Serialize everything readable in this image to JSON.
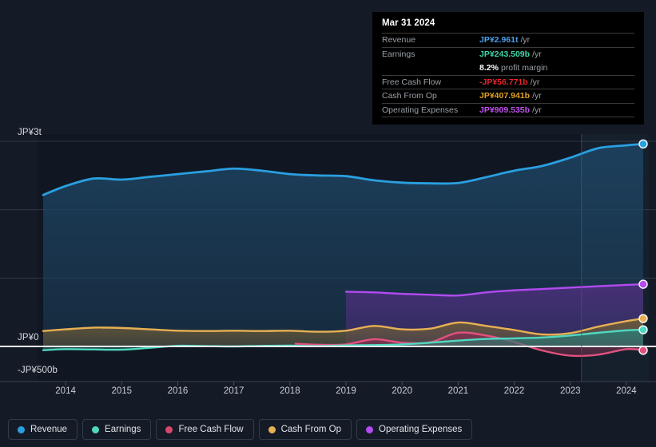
{
  "chart_data": {
    "type": "area",
    "title": "",
    "xlabel": "",
    "ylabel": "",
    "currency": "JP¥",
    "ylim": [
      -500,
      3000
    ],
    "ylim_unit": "billions JP¥",
    "grid": true,
    "legend_position": "bottom-left",
    "y_ticks": [
      {
        "label": "JP¥3t",
        "value": 3000
      },
      {
        "label": "JP¥0",
        "value": 0
      },
      {
        "label": "-JP¥500b",
        "value": -500
      }
    ],
    "y_gridlines": [
      3000,
      2000,
      1000,
      0
    ],
    "x_ticks": [
      "2014",
      "2015",
      "2016",
      "2017",
      "2018",
      "2019",
      "2020",
      "2021",
      "2022",
      "2023",
      "2024"
    ],
    "x_range": [
      "2013.5",
      "2024.4"
    ],
    "forecast_divider_x": "2023.2",
    "series": [
      {
        "name": "Revenue",
        "color": "#2a9fe0",
        "fill": "#1d4260",
        "x": [
          2013.6,
          2014.0,
          2014.5,
          2015.0,
          2015.5,
          2016.0,
          2016.5,
          2017.0,
          2017.5,
          2018.0,
          2018.5,
          2019.0,
          2019.5,
          2020.0,
          2020.5,
          2021.0,
          2021.5,
          2022.0,
          2022.5,
          2023.0,
          2023.5,
          2024.0,
          2024.3
        ],
        "values": [
          2215,
          2345,
          2455,
          2440,
          2480,
          2520,
          2560,
          2600,
          2570,
          2520,
          2500,
          2490,
          2430,
          2395,
          2385,
          2390,
          2475,
          2570,
          2640,
          2760,
          2900,
          2940,
          2961
        ]
      },
      {
        "name": "Earnings",
        "color": "#4fd8c0",
        "fill": "#2e7a72",
        "x": [
          2013.6,
          2014.0,
          2014.5,
          2015.0,
          2015.5,
          2016.0,
          2016.5,
          2017.0,
          2017.5,
          2018.0,
          2018.5,
          2019.0,
          2019.5,
          2020.0,
          2020.5,
          2021.0,
          2021.5,
          2022.0,
          2022.5,
          2023.0,
          2023.5,
          2024.0,
          2024.3
        ],
        "values": [
          -55,
          -40,
          -45,
          -48,
          -20,
          10,
          5,
          0,
          8,
          12,
          5,
          15,
          20,
          30,
          55,
          85,
          110,
          118,
          130,
          160,
          200,
          235,
          243.509
        ]
      },
      {
        "name": "Free Cash Flow",
        "color": "#e0527e",
        "fill": "#7a3350",
        "x": [
          2018.1,
          2018.5,
          2019.0,
          2019.5,
          2020.0,
          2020.5,
          2021.0,
          2021.5,
          2022.0,
          2022.5,
          2023.0,
          2023.5,
          2024.0,
          2024.3
        ],
        "values": [
          40,
          25,
          30,
          105,
          55,
          60,
          200,
          160,
          65,
          -60,
          -135,
          -120,
          -40,
          -56.771
        ]
      },
      {
        "name": "Cash From Op",
        "color": "#e8b053",
        "fill": "#6d5c38",
        "x": [
          2013.6,
          2014.0,
          2014.5,
          2015.0,
          2015.5,
          2016.0,
          2016.5,
          2017.0,
          2017.5,
          2018.0,
          2018.5,
          2019.0,
          2019.5,
          2020.0,
          2020.5,
          2021.0,
          2021.5,
          2022.0,
          2022.5,
          2023.0,
          2023.5,
          2024.0,
          2024.3
        ],
        "values": [
          225,
          250,
          275,
          270,
          250,
          230,
          225,
          230,
          225,
          230,
          215,
          230,
          300,
          250,
          260,
          350,
          300,
          240,
          175,
          195,
          290,
          370,
          407.941
        ]
      },
      {
        "name": "Operating Expenses",
        "color": "#b24bf0",
        "fill": "#4a2f7a",
        "x": [
          2019.0,
          2019.5,
          2020.0,
          2020.5,
          2021.0,
          2021.5,
          2022.0,
          2022.5,
          2023.0,
          2023.5,
          2024.0,
          2024.3
        ],
        "values": [
          800,
          790,
          770,
          755,
          745,
          790,
          820,
          840,
          860,
          880,
          900,
          909.535
        ]
      }
    ]
  },
  "tooltip": {
    "title": "Mar 31 2024",
    "rows": [
      {
        "key": "Revenue",
        "value": "JP¥2.961t",
        "unit": "/yr",
        "color": "#4a9fe8"
      },
      {
        "key": "Earnings",
        "value": "JP¥243.509b",
        "unit": "/yr",
        "color": "#3dd6a8"
      },
      {
        "key": "",
        "value": "8.2%",
        "unit": "profit margin",
        "color": "#ffffff"
      },
      {
        "key": "Free Cash Flow",
        "value": "-JP¥56.771b",
        "unit": "/yr",
        "color": "#e8252b"
      },
      {
        "key": "Cash From Op",
        "value": "JP¥407.941b",
        "unit": "/yr",
        "color": "#e0a020"
      },
      {
        "key": "Operating Expenses",
        "value": "JP¥909.535b",
        "unit": "/yr",
        "color": "#c44ff0"
      }
    ]
  },
  "legend": {
    "items": [
      {
        "label": "Revenue",
        "color": "#2a9fe0"
      },
      {
        "label": "Earnings",
        "color": "#4fd8c0"
      },
      {
        "label": "Free Cash Flow",
        "color": "#d9476f"
      },
      {
        "label": "Cash From Op",
        "color": "#e8b053"
      },
      {
        "label": "Operating Expenses",
        "color": "#b24bf0"
      }
    ]
  }
}
